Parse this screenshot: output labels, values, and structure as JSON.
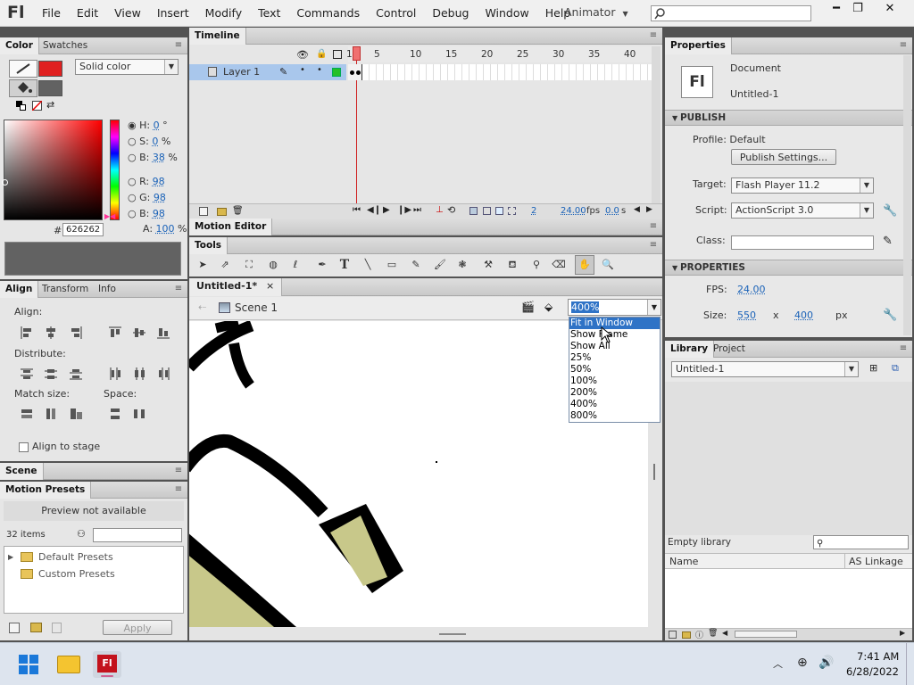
{
  "app": {
    "logo": "Fl",
    "menus": [
      "File",
      "Edit",
      "View",
      "Insert",
      "Modify",
      "Text",
      "Commands",
      "Control",
      "Debug",
      "Window",
      "Help"
    ],
    "workspace": "Animator"
  },
  "color_panel": {
    "tabs": [
      "Color",
      "Swatches"
    ],
    "fill_type": "Solid color",
    "stroke_color": "#e02020",
    "fill_color": "#626262",
    "hsb": {
      "h_label": "H:",
      "h": "0",
      "h_unit": "°",
      "s_label": "S:",
      "s": "0",
      "s_unit": "%",
      "b_label": "B:",
      "b": "38",
      "b_unit": "%"
    },
    "rgb": {
      "r_label": "R:",
      "r": "98",
      "g_label": "G:",
      "g": "98",
      "b_label": "B:",
      "b": "98",
      "a_label": "A:",
      "a": "100",
      "a_unit": "%"
    },
    "hex_label": "#",
    "hex": "626262"
  },
  "align_panel": {
    "tabs": [
      "Align",
      "Transform",
      "Info"
    ],
    "align_label": "Align:",
    "distribute_label": "Distribute:",
    "match_label": "Match size:",
    "space_label": "Space:",
    "align_to_stage": "Align to stage"
  },
  "scene_panel": {
    "tab": "Scene"
  },
  "motion_presets": {
    "tab": "Motion Presets",
    "preview": "Preview not available",
    "count": "32 items",
    "items": [
      "Default Presets",
      "Custom Presets"
    ],
    "apply": "Apply"
  },
  "timeline": {
    "tab": "Timeline",
    "layer": "Layer 1",
    "frame_numbers": [
      "1",
      "5",
      "10",
      "15",
      "20",
      "25",
      "30",
      "35",
      "40"
    ],
    "current_frame": "2",
    "fps": "24.00",
    "fps_unit": "fps",
    "time": "0.0",
    "time_unit": "s"
  },
  "motion_editor": {
    "tab": "Motion Editor"
  },
  "tools": {
    "tab": "Tools"
  },
  "document_tab": {
    "name": "Untitled-1*",
    "close": "×"
  },
  "stage": {
    "scene": "Scene 1",
    "zoom": "400%",
    "zoom_options": [
      "Fit in Window",
      "Show Frame",
      "Show All",
      "25%",
      "50%",
      "100%",
      "200%",
      "400%",
      "800%"
    ],
    "zoom_highlight": "Fit in Window"
  },
  "properties": {
    "tab": "Properties",
    "doc_type": "Document",
    "doc_name": "Untitled-1",
    "icon_text": "Fl",
    "publish": {
      "header": "PUBLISH",
      "profile": "Profile: Default",
      "publish_settings": "Publish Settings...",
      "target_label": "Target:",
      "target": "Flash Player 11.2",
      "script_label": "Script:",
      "script": "ActionScript 3.0",
      "class_label": "Class:"
    },
    "props": {
      "header": "PROPERTIES",
      "fps_label": "FPS:",
      "fps": "24.00",
      "size_label": "Size:",
      "width": "550",
      "x": "x",
      "height": "400",
      "unit": "px"
    }
  },
  "library": {
    "tabs": [
      "Library",
      "Project"
    ],
    "doc": "Untitled-1",
    "empty": "Empty library",
    "col_name": "Name",
    "col_linkage": "AS Linkage"
  },
  "taskbar": {
    "time": "7:41 AM",
    "date": "6/28/2022"
  }
}
